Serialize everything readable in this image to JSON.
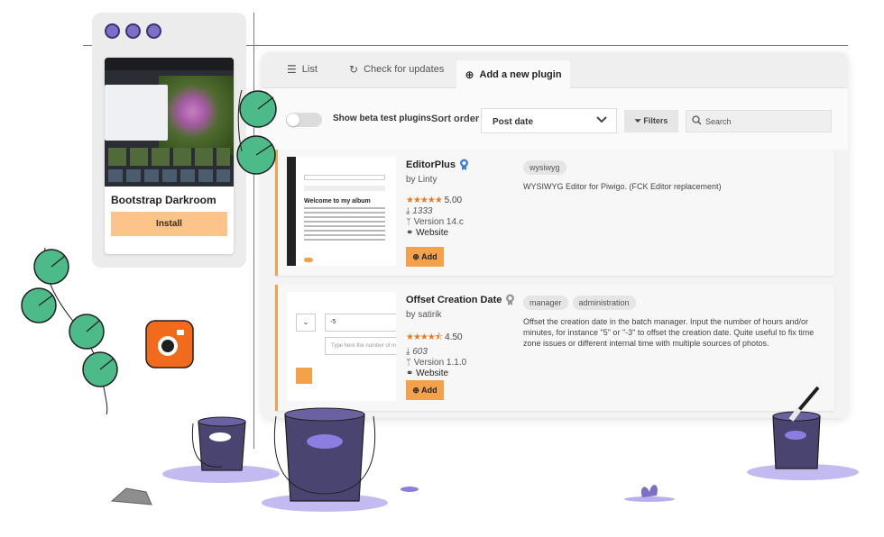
{
  "mini_window": {
    "theme_name": "Bootstrap Darkroom",
    "install_label": "Install"
  },
  "tabs": [
    {
      "label": "List",
      "icon": "list-icon"
    },
    {
      "label": "Check for updates",
      "icon": "refresh-icon"
    },
    {
      "label": "Add a new plugin",
      "icon": "plus-circle-icon"
    }
  ],
  "toolbar": {
    "beta_label": "Show beta test plugins",
    "sort_label": "Sort order",
    "sort_value": "Post date",
    "filters_label": "Filters",
    "search_placeholder": "Search"
  },
  "plugins": [
    {
      "name": "EditorPlus",
      "badge": "verified-badge-icon",
      "badge_color": "#3b82d6",
      "author": "by Linty",
      "stars": "★★★★★",
      "rating": "5.00",
      "downloads": "1333",
      "version": "Version 14.c",
      "website": "Website",
      "add_label": "Add",
      "tags": [
        "wysiwyg"
      ],
      "description": "WYSIWYG Editor for Piwigo. (FCK Editor replacement)",
      "thumb": {
        "heading": "Welcome to my album"
      }
    },
    {
      "name": "Offset Creation Date",
      "badge": "unverified-badge-icon",
      "badge_color": "#9a9a9a",
      "author": "by satirik",
      "stars": "★★★★⯪",
      "rating": "4.50",
      "downloads": "603",
      "version": "Version 1.1.0",
      "website": "Website",
      "add_label": "Add",
      "tags": [
        "manager",
        "administration"
      ],
      "description": "Offset the creation date in the batch manager. Input the number of hours and/or minutes, for instance \"5\" or \"-3\" to offset the creation date. Quite useful to fix time zone issues or different internal time with multiple sources of photos.",
      "thumb": {
        "input_value": "-5",
        "input_placeholder": "Type here the number of minutes"
      }
    }
  ],
  "colors": {
    "accent": "#f3a24b",
    "install_button": "#fcc48b",
    "decor_green": "#4dba8a",
    "decor_purple": "#7b6fc6",
    "bucket": "#4a4570"
  }
}
